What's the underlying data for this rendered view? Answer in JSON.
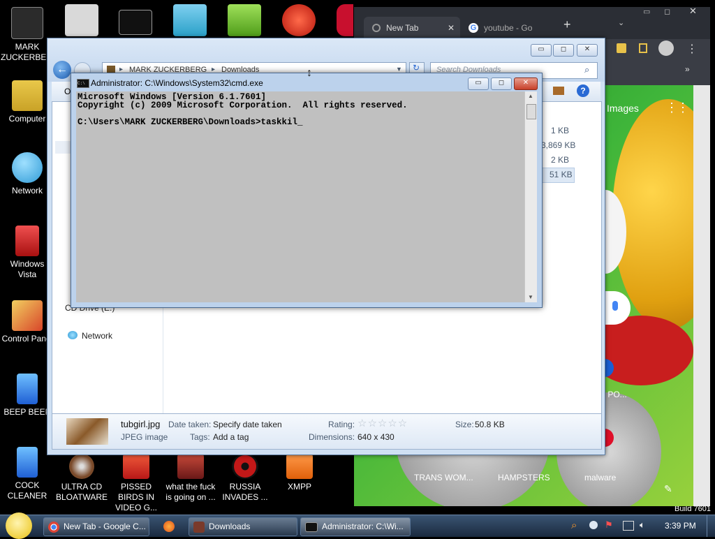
{
  "desktop": {
    "left_icons": [
      {
        "label": "MARK ZUCKERBERG",
        "color": "#2b2b2b"
      },
      {
        "label": "Computer",
        "color": "#c9a227"
      },
      {
        "label": "Network",
        "color": "#2f9ad6"
      },
      {
        "label": "Windows Vista",
        "color": "#c81e1e"
      },
      {
        "label": "Control Panel",
        "color": "#d8452a"
      },
      {
        "label": "BEEP BEEP",
        "color": "#1f7fd4"
      },
      {
        "label": "COCK CLEANER",
        "color": "#1f7fd4"
      }
    ],
    "bottom_icons": [
      {
        "label": "ULTRA CD BLOATWARE",
        "color": "#7a4a2a"
      },
      {
        "label": "PISSED BIRDS IN VIDEO G...",
        "color": "#d02a2a"
      },
      {
        "label": "what the fuck is going on ...",
        "color": "#b8182a"
      },
      {
        "label": "RUSSIA INVADES ...",
        "color": "#c21818"
      },
      {
        "label": "XMPP",
        "color": "#f07a1a"
      }
    ],
    "top_icons": [
      {
        "name": "text-document-icon",
        "color": "#d9d9d9"
      },
      {
        "name": "cmd-shortcut-icon",
        "color": "#111111"
      },
      {
        "name": "burning-software-icon",
        "color": "#2aa0c8"
      },
      {
        "name": "bad-piggies-icon",
        "color": "#6fbd2a"
      },
      {
        "name": "p-app-icon",
        "color": "#e0281e"
      },
      {
        "name": "red-app-icon",
        "color": "#c8102e"
      }
    ],
    "build_text": "Build 7601"
  },
  "chrome": {
    "tab_new": "New Tab",
    "tab_youtube": "youtube - Go",
    "new_tab_button": "+",
    "images_link": "Images",
    "shortcut_partial": "X PO...",
    "shortcuts": [
      "TRANS WOM...",
      "HAMPSTERS",
      "malware"
    ]
  },
  "explorer": {
    "breadcrumb": [
      "MARK ZUCKERBERG",
      "Downloads"
    ],
    "search_placeholder": "Search Downloads",
    "toolbar_partial": "O",
    "file_sizes": [
      "1 KB",
      "3,869 KB",
      "2 KB",
      "51 KB"
    ],
    "nav_drive": "CD Drive (E:)",
    "nav_network": "Network",
    "details": {
      "file_name": "tubgirl.jpg",
      "file_type": "JPEG image",
      "date_taken_label": "Date taken:",
      "date_taken_value": "Specify date taken",
      "tags_label": "Tags:",
      "tags_value": "Add a tag",
      "rating_label": "Rating:",
      "rating_stars": "☆☆☆☆☆",
      "dimensions_label": "Dimensions:",
      "dimensions_value": "640 x 430",
      "size_label": "Size:",
      "size_value": "50.8 KB"
    }
  },
  "cmd": {
    "title": "Administrator: C:\\Windows\\System32\\cmd.exe",
    "icon_text": "C:\\",
    "lines": [
      "Microsoft Windows [Version 6.1.7601]",
      "Copyright (c) 2009 Microsoft Corporation.  All rights reserved.",
      "",
      "C:\\Users\\MARK ZUCKERBERG\\Downloads>taskkil_"
    ]
  },
  "taskbar": {
    "buttons": [
      {
        "label": "New Tab - Google C...",
        "color": "#4285f4"
      },
      {
        "label": "",
        "color": "#ff7a1a"
      },
      {
        "label": "Downloads",
        "color": "#e0b040"
      },
      {
        "label": "Administrator: C:\\Wi...",
        "color": "#111111"
      }
    ],
    "clock": "3:39 PM"
  }
}
